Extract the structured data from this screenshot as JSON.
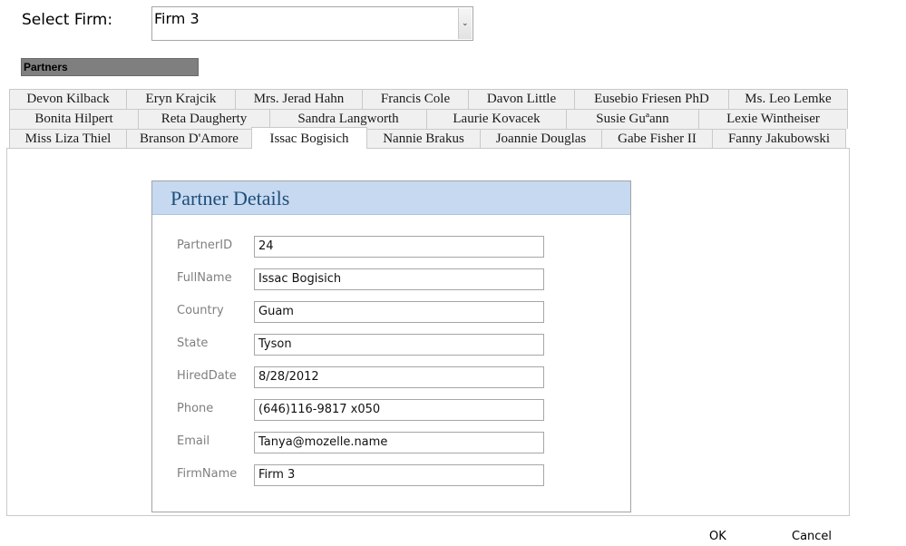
{
  "select_firm": {
    "label": "Select Firm:",
    "value": "Firm 3"
  },
  "partners_header": "Partners",
  "tabs": {
    "row1": [
      "Devon Kilback",
      "Eryn Krajcik",
      "Mrs. Jerad Hahn",
      "Francis Cole",
      "Davon Little",
      "Eusebio Friesen PhD",
      "Ms. Leo Lemke"
    ],
    "row2": [
      "Bonita Hilpert",
      "Reta Daugherty",
      "Sandra Langworth",
      "Laurie Kovacek",
      "Susie Guªann",
      "Lexie Wintheiser"
    ],
    "row3": [
      "Miss Liza Thiel",
      "Branson D'Amore",
      "Issac Bogisich",
      "Nannie Brakus",
      "Joannie Douglas",
      "Gabe Fisher II",
      "Fanny Jakubowski"
    ]
  },
  "active_tab": "Issac Bogisich",
  "details": {
    "title": "Partner Details",
    "fields": [
      {
        "label": "PartnerID",
        "value": "24"
      },
      {
        "label": "FullName",
        "value": "Issac Bogisich"
      },
      {
        "label": "Country",
        "value": "Guam"
      },
      {
        "label": "State",
        "value": "Tyson"
      },
      {
        "label": "HiredDate",
        "value": "8/28/2012"
      },
      {
        "label": "Phone",
        "value": "(646)116-9817 x050"
      },
      {
        "label": "Email",
        "value": "Tanya@mozelle.name"
      },
      {
        "label": "FirmName",
        "value": "Firm 3"
      }
    ]
  },
  "buttons": {
    "ok": "OK",
    "cancel": "Cancel"
  }
}
